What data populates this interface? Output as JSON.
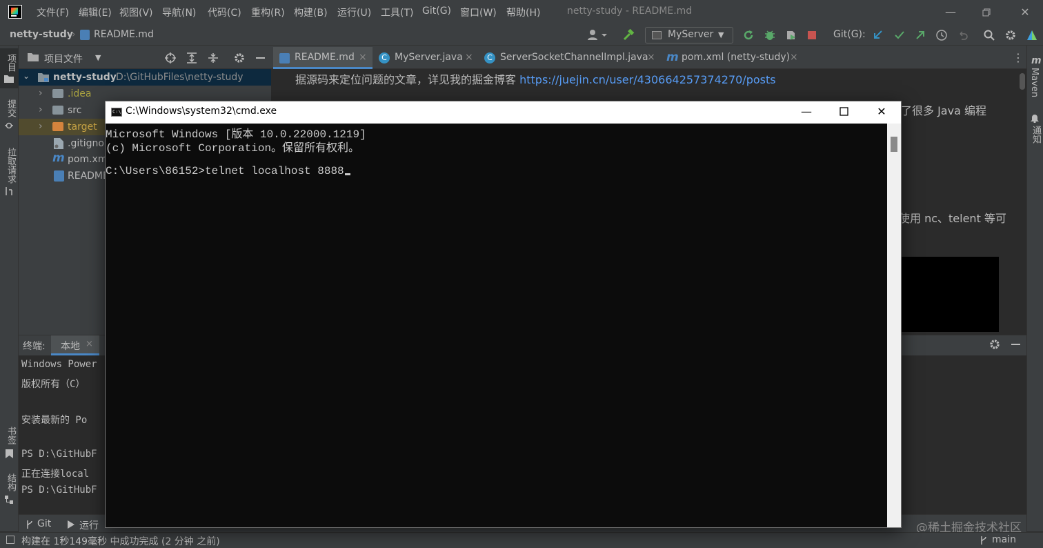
{
  "menu": {
    "items": [
      "文件(F)",
      "编辑(E)",
      "视图(V)",
      "导航(N)",
      "代码(C)",
      "重构(R)",
      "构建(B)",
      "运行(U)",
      "工具(T)",
      "Git(G)",
      "窗口(W)",
      "帮助(H)"
    ],
    "window_title": "netty-study - README.md"
  },
  "breadcrumb": {
    "project": "netty-study",
    "file": "README.md"
  },
  "toolbar": {
    "run_config": "MyServer",
    "git_label": "Git(G):"
  },
  "left_strip": {
    "project": "项目",
    "commit": "提交",
    "pull_requests": "拉取请求",
    "bookmarks": "书签",
    "structure": "结构"
  },
  "right_strip": {
    "maven": "Maven",
    "notifications": "通知"
  },
  "project_panel": {
    "title": "项目文件",
    "root": {
      "name": "netty-study",
      "path": "D:\\GitHubFiles\\netty-study"
    },
    "items": [
      ".idea",
      "src",
      "target",
      ".gitignore",
      "pom.xml",
      "README.md"
    ]
  },
  "tabs": [
    "README.md",
    "MyServer.java",
    "ServerSocketChannelImpl.java",
    "pom.xml (netty-study)"
  ],
  "editor": {
    "line1_text": "据源码来定位问题的文章，详见我的掘金博客 ",
    "line1_link": "https://juejin.cn/user/430664257374270/posts",
    "frag1": "了很多 Java 编程",
    "frag2": "使用 nc、telent 等可"
  },
  "terminal": {
    "title": "终端:",
    "tab": "本地",
    "lines": [
      "Windows Power",
      "版权所有（C）",
      "",
      "安装最新的 Po",
      "",
      "PS D:\\GitHubF",
      "正在连接local",
      "PS D:\\GitHubF"
    ]
  },
  "bottom_tools": {
    "git": "Git",
    "run": "运行"
  },
  "status": {
    "text": "构建在 1秒149毫秒 中成功完成 (2 分钟 之前)",
    "branch": "main",
    "watermark": "@稀土掘金技术社区"
  },
  "cmd": {
    "title": "C:\\Windows\\system32\\cmd.exe",
    "icon_text": "C:\\",
    "lines": [
      "Microsoft Windows [版本 10.0.22000.1219]",
      "(c) Microsoft Corporation。保留所有权利。",
      "",
      "C:\\Users\\86152>telnet localhost 8888"
    ]
  },
  "colors": {
    "accent": "#4a88c7",
    "link": "#589df6",
    "ide_bg": "#2b2b2b",
    "panel_bg": "#3c3f41",
    "cmd_bg": "#0c0c0c"
  }
}
